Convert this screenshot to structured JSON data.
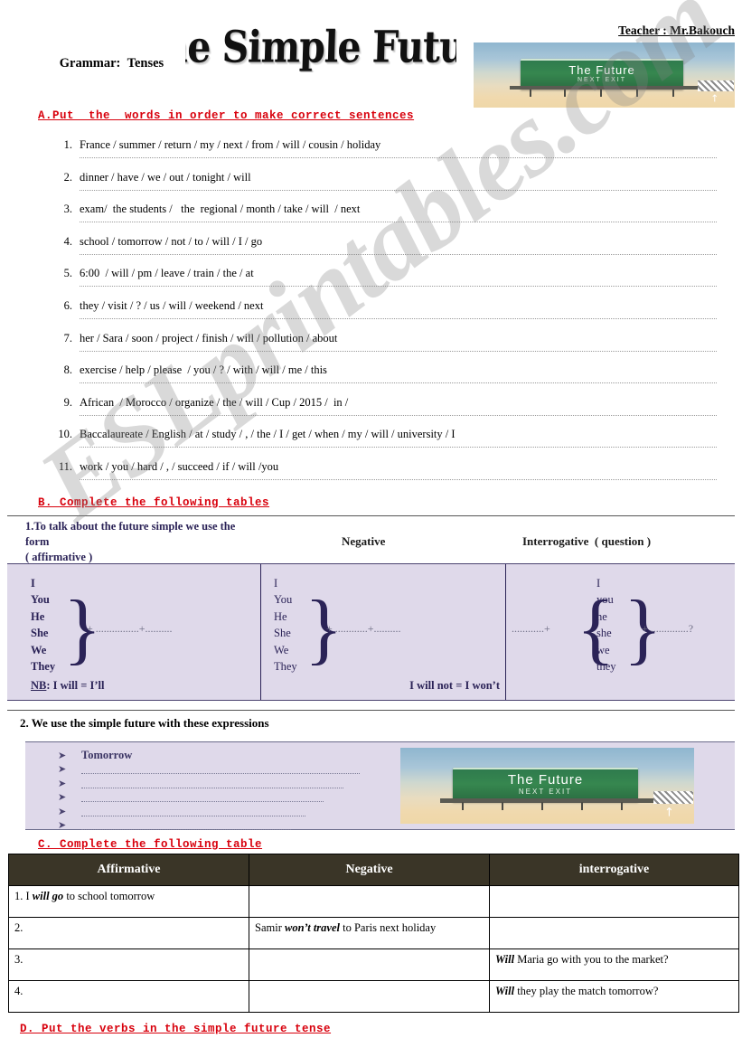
{
  "header": {
    "subject_label": "Grammar:",
    "subject_value": "Tenses",
    "title": "The Simple Future",
    "teacher": "Teacher : Mr.Bakouch",
    "road_sign": {
      "main": "The Future",
      "sub": "NEXT EXIT",
      "arrow": "↗"
    }
  },
  "watermark": "ESLprintables.com",
  "section_a": {
    "heading": "A.Put  the  words in order to make correct sentences",
    "items": [
      {
        "num": "1.",
        "text": "France / summer / return / my / next / from / will / cousin / holiday"
      },
      {
        "num": "2.",
        "text": "dinner / have / we / out / tonight / will"
      },
      {
        "num": "3.",
        "text": "exam/  the students /   the  regional / month / take / will  / next"
      },
      {
        "num": "4.",
        "text": "school / tomorrow / not / to / will / I / go"
      },
      {
        "num": "5.",
        "text": "6:00  / will / pm / leave / train / the / at"
      },
      {
        "num": "6.",
        "text": "they / visit / ? / us / will / weekend / next"
      },
      {
        "num": "7.",
        "text": "her / Sara / soon / project / finish / will / pollution / about"
      },
      {
        "num": "8.",
        "text": "exercise / help / please  / you / ? / with / will / me / this"
      },
      {
        "num": "9.",
        "text": "African  / Morocco / organize / the / will / Cup / 2015 /  in /"
      },
      {
        "num": "10.",
        "text": "Baccalaureate / English / at / study / , / the / I / get / when / my / will / university / I"
      },
      {
        "num": "11.",
        "text": "work / you / hard / , / succeed / if / will /you"
      }
    ]
  },
  "section_b": {
    "heading": "B. Complete the following tables",
    "table1": {
      "col1_header_line1": "1.To talk about the future simple we use the",
      "col1_header_line2": "form",
      "col1_header_line3": " ( affirmative )",
      "col2_header": "Negative",
      "col3_header": "Interrogative  ( question )",
      "affirmative_pronouns": [
        "I",
        "You",
        "He",
        "She",
        "We",
        "They"
      ],
      "affirmative_blank": "+ ................+..........",
      "affirmative_note": "NB",
      "affirmative_note_text": ": I will = I’ll",
      "negative_pronouns": [
        "I",
        "You",
        "He",
        "She",
        "We",
        "They"
      ],
      "negative_blank": "+ ............+..........",
      "negative_note": "I will not = I won’t",
      "interrogative_pronouns": [
        "I",
        "you",
        "he",
        "she",
        "we",
        "they"
      ],
      "interrogative_blank_before": "............+",
      "interrogative_blank_after": "+ ..............?"
    },
    "section2_title": "2. We use the simple future with these expressions",
    "expressions": [
      "Tomorrow",
      "............................................................",
      "......................................................",
      "................................................",
      "..........................................",
      "....................................."
    ]
  },
  "section_c": {
    "heading": "C. Complete the following table",
    "columns": [
      "Affirmative",
      "Negative",
      "interrogative"
    ],
    "rows": [
      {
        "affirmative_num": "1. I ",
        "affirmative_bold": "will go",
        "affirmative_rest": " to school tomorrow",
        "negative_num": "",
        "negative_bold": "",
        "negative_rest": "",
        "interrogative_num": "",
        "interrogative_bold": "",
        "interrogative_rest": ""
      },
      {
        "affirmative_num": "2.",
        "affirmative_bold": "",
        "affirmative_rest": "",
        "negative_num": "Samir ",
        "negative_bold": "won’t travel",
        "negative_rest": " to Paris next holiday",
        "interrogative_num": "",
        "interrogative_bold": "",
        "interrogative_rest": ""
      },
      {
        "affirmative_num": "3.",
        "affirmative_bold": "",
        "affirmative_rest": "",
        "negative_num": "",
        "negative_bold": "",
        "negative_rest": "",
        "interrogative_num": "",
        "interrogative_bold": "Will",
        "interrogative_rest": " Maria go with you to the market?"
      },
      {
        "affirmative_num": "4.",
        "affirmative_bold": "",
        "affirmative_rest": "",
        "negative_num": "",
        "negative_bold": "",
        "negative_rest": "",
        "interrogative_num": "",
        "interrogative_bold": "Will",
        "interrogative_rest": " they play the match tomorrow?"
      }
    ]
  },
  "section_d": {
    "heading": "D. Put the verbs in the simple future tense"
  },
  "colors": {
    "red_heading": "#d8000c",
    "table_b_fill": "#dfd9ea",
    "table_b_text": "#2b2357",
    "table_c_header": "#3a3527",
    "sign_green": "#36874f"
  }
}
